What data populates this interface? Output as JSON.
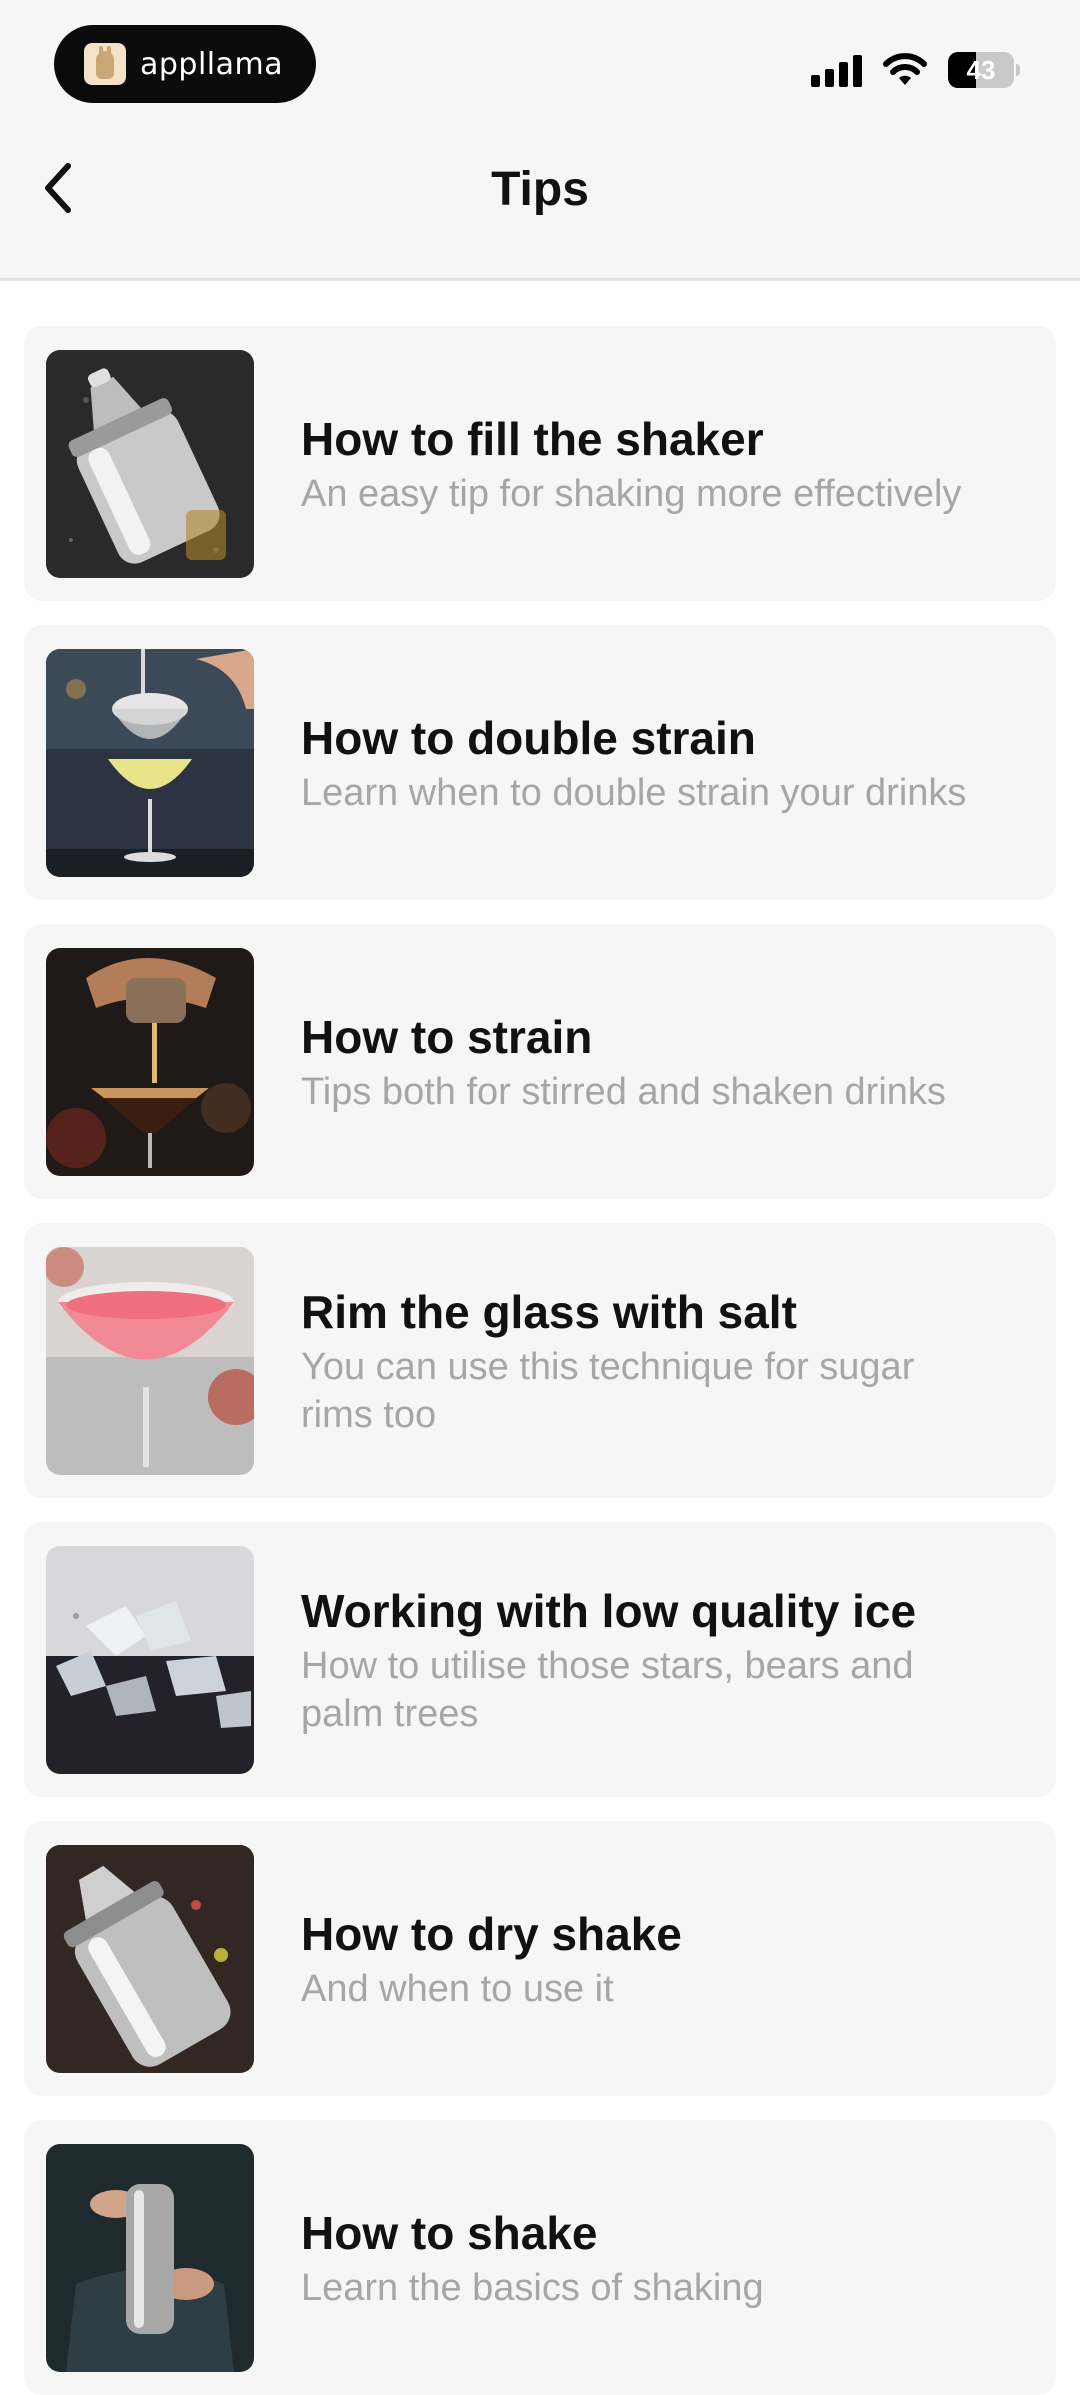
{
  "status_bar": {
    "app_badge": "appllama",
    "battery": "43",
    "battery_level": 0.43
  },
  "header": {
    "title": "Tips"
  },
  "tips": [
    {
      "title": "How to fill the shaker",
      "subtitle": "An easy tip for shaking more effectively"
    },
    {
      "title": "How to double strain",
      "subtitle": "Learn when to double strain your drinks"
    },
    {
      "title": "How to strain",
      "subtitle": "Tips both for stirred and shaken drinks"
    },
    {
      "title": "Rim the glass with salt",
      "subtitle": "You can use this technique for sugar rims too"
    },
    {
      "title": "Working with low quality ice",
      "subtitle": "How to utilise those stars, bears and palm trees"
    },
    {
      "title": "How to dry shake",
      "subtitle": "And when to use it"
    },
    {
      "title": "How to shake",
      "subtitle": "Learn the basics of shaking"
    }
  ]
}
